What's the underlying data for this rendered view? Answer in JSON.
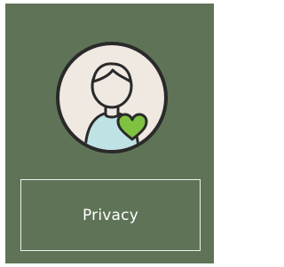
{
  "card": {
    "background": "#5f7457",
    "icon": "person-with-heart-icon",
    "button": {
      "label": "Privacy"
    }
  },
  "colors": {
    "icon_background": "#efe9e2",
    "icon_outline": "#2a2a2a",
    "heart": "#7fc241",
    "shirt": "#bfe3e4",
    "label": "#ffffff"
  }
}
